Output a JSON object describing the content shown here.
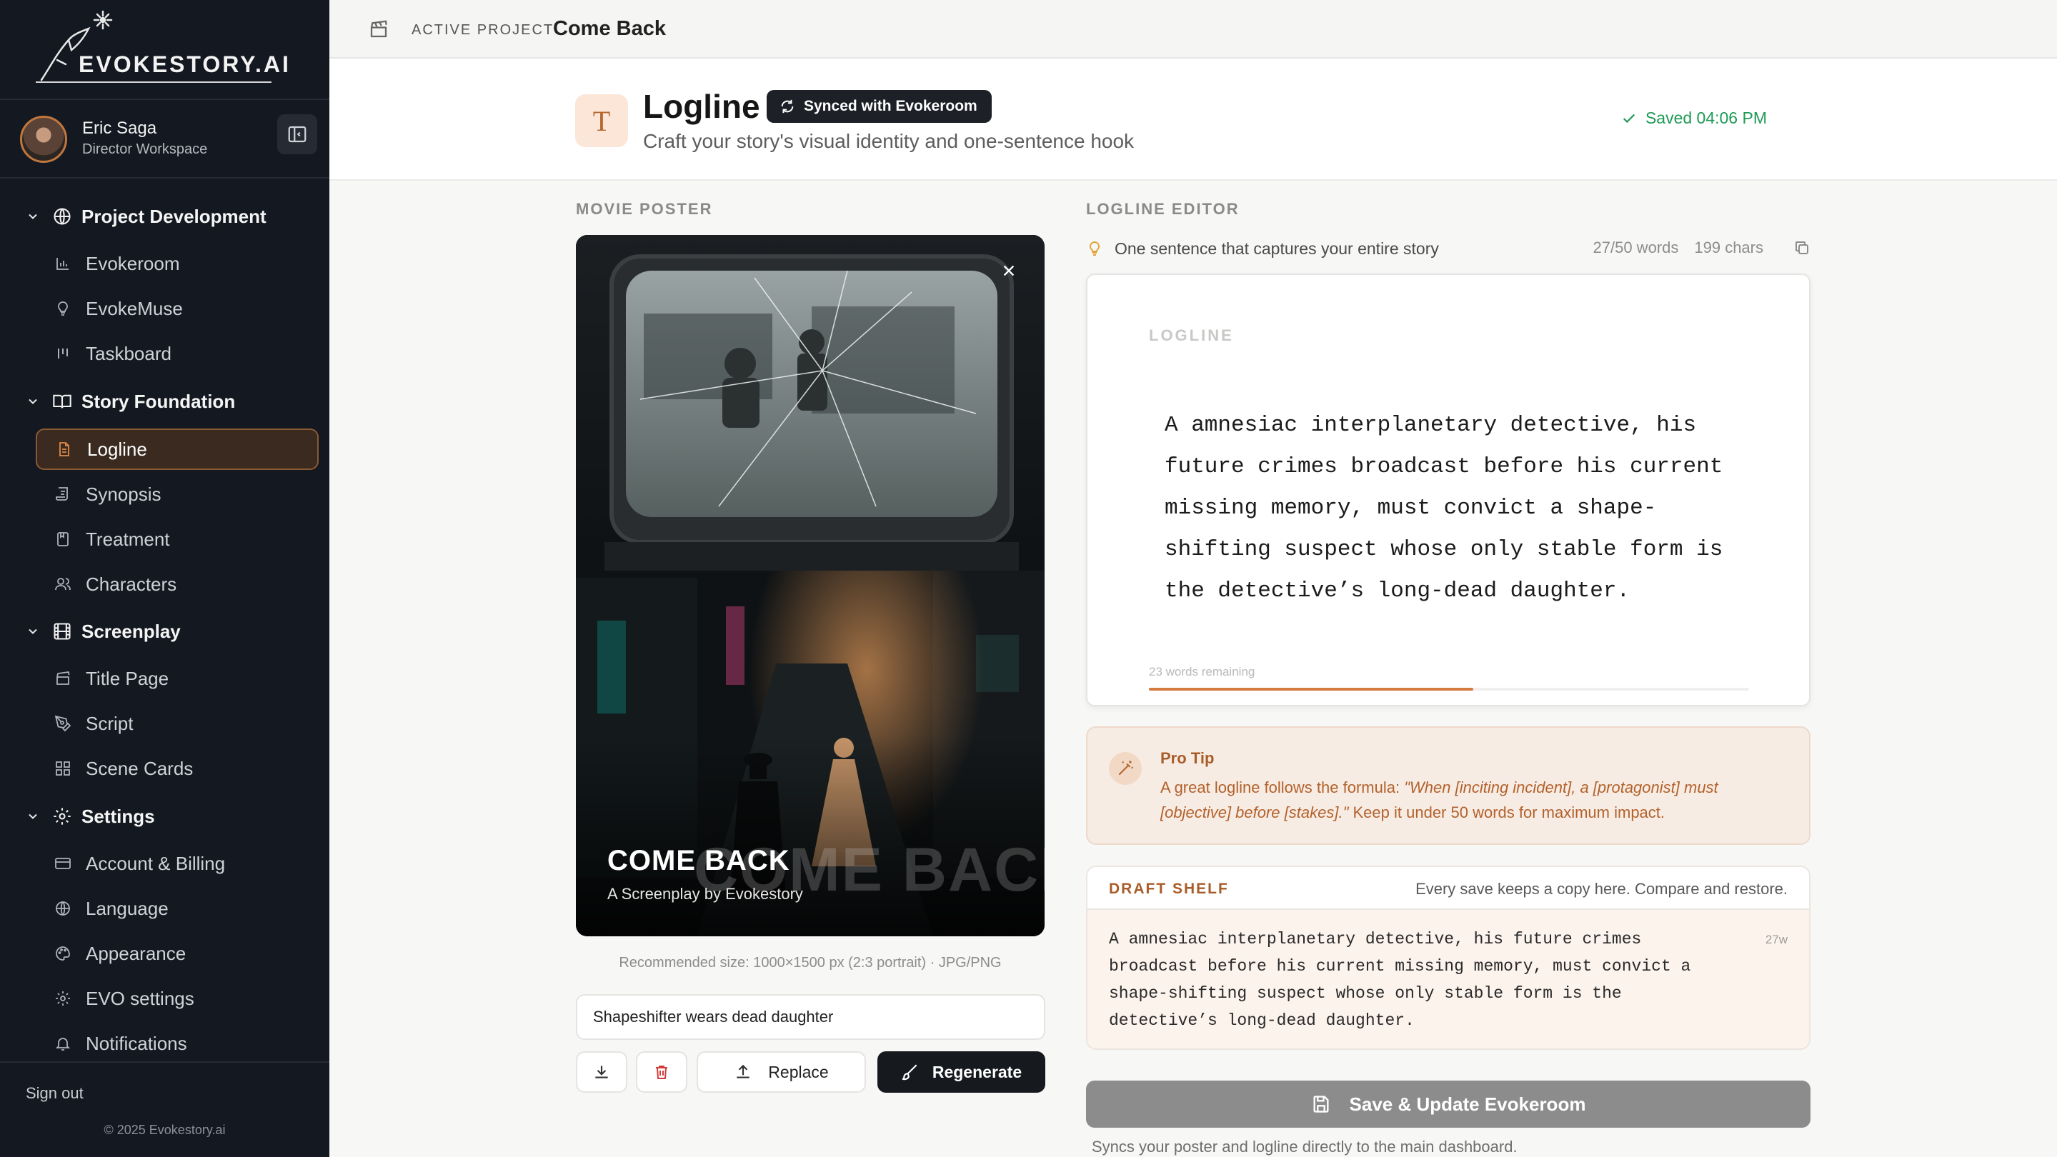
{
  "brand": {
    "logo_text": "EVOKESTORY.AI"
  },
  "user": {
    "name": "Eric Saga",
    "role": "Director Workspace"
  },
  "sidebar": {
    "sections": [
      {
        "label": "Project Development",
        "items": [
          "Evokeroom",
          "EvokeMuse",
          "Taskboard"
        ]
      },
      {
        "label": "Story Foundation",
        "items": [
          "Logline",
          "Synopsis",
          "Treatment",
          "Characters"
        ]
      },
      {
        "label": "Screenplay",
        "items": [
          "Title Page",
          "Script",
          "Scene Cards"
        ]
      },
      {
        "label": "Settings",
        "items": [
          "Account & Billing",
          "Language",
          "Appearance",
          "EVO settings",
          "Notifications"
        ]
      }
    ],
    "active_item": "Logline",
    "sign_out": "Sign out",
    "copyright": "© 2025 Evokestory.ai"
  },
  "topbar": {
    "label": "ACTIVE PROJECT",
    "project": "Come Back"
  },
  "header": {
    "badge_letter": "T",
    "title": "Logline",
    "sync_label": "Synced with Evokeroom",
    "subtitle": "Craft your story's visual identity and one-sentence hook",
    "saved": "Saved 04:06 PM"
  },
  "poster": {
    "section_label": "MOVIE POSTER",
    "title": "COME BACK",
    "subtitle": "A Screenplay by Evokestory",
    "recommended": "Recommended size: 1000×1500 px (2:3 portrait) · JPG/PNG",
    "prompt_value": "Shapeshifter wears dead daughter",
    "replace_label": "Replace",
    "regenerate_label": "Regenerate"
  },
  "editor": {
    "section_label": "LOGLINE EDITOR",
    "hint": "One sentence that captures your entire story",
    "word_count": "27/50 words",
    "char_count": "199 chars",
    "field_label": "LOGLINE",
    "text": "A amnesiac interplanetary detective, his future crimes broadcast before his current missing memory, must convict a shape-shifting suspect whose only stable form is the detective’s long-dead daughter.",
    "remaining": "23 words remaining",
    "progress": 0.54
  },
  "protip": {
    "title": "Pro Tip",
    "lead": "A great logline follows the formula: ",
    "formula": "\"When [inciting incident], a [protagonist] must [objective] before [stakes].\"",
    "tail": " Keep it under 50 words for maximum impact."
  },
  "draft_shelf": {
    "title": "DRAFT SHELF",
    "note": "Every save keeps a copy here. Compare and restore.",
    "drafts": [
      {
        "text": "A amnesiac interplanetary detective, his future crimes broadcast before his current missing memory, must convict a shape-shifting suspect whose only stable form is the detective’s long-dead daughter.",
        "words": "27w"
      }
    ]
  },
  "actions": {
    "save_label": "Save & Update Evokeroom",
    "save_note": "Syncs your poster and logline directly to the main dashboard."
  }
}
